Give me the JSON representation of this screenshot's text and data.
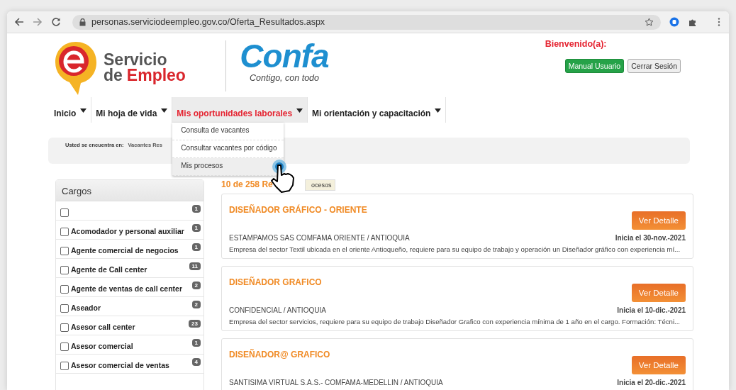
{
  "browser": {
    "url": "personas.serviciodeempleo.gov.co/Oferta_Resultados.aspx"
  },
  "header": {
    "logo_line1": "Servicio",
    "logo_line2_a": "de",
    "logo_line2_b": "Empleo",
    "partner_name": "Confa",
    "partner_tagline": "Contigo, con todo",
    "welcome": "Bienvenido(a):",
    "buttons": [
      {
        "label": "Manual Usuario",
        "kind": "primary"
      },
      {
        "label": "Cerrar Sesión",
        "kind": "secondary"
      }
    ]
  },
  "nav": [
    {
      "label": "Inicio",
      "selected": false
    },
    {
      "label": "Mi hoja de vida",
      "selected": false
    },
    {
      "label": "Mis oportunidades laborales",
      "selected": true,
      "menu": [
        {
          "label": "Consulta de vacantes",
          "highlighted": false
        },
        {
          "label": "Consultar vacantes por código",
          "highlighted": false
        },
        {
          "label": "Mis procesos",
          "highlighted": true
        }
      ]
    },
    {
      "label": "Mi orientación y capacitación",
      "selected": false
    }
  ],
  "breadcrumb": {
    "label": "Usted se encuentra en:",
    "current": "Vacantes Res"
  },
  "tooltip": "ocesos",
  "sidebar": {
    "title": "Cargos",
    "items": [
      {
        "checked": false,
        "count": "1"
      },
      {
        "label": "Acomodador y personal auxiliar",
        "checked": false,
        "count": "1"
      },
      {
        "label": "Agente comercial de negocios",
        "checked": false,
        "count": "1"
      },
      {
        "label": "Agente de Call center",
        "checked": false,
        "count": "11"
      },
      {
        "label": "Agente de ventas de call center",
        "checked": false,
        "count": "2"
      },
      {
        "label": "Aseador",
        "checked": false,
        "count": "2"
      },
      {
        "label": "Asesor call center",
        "checked": false,
        "count": "23"
      },
      {
        "label": "Asesor comercial",
        "checked": false,
        "count": "1"
      },
      {
        "label": "Asesor comercial de ventas",
        "checked": false,
        "count": "4"
      }
    ]
  },
  "results": {
    "count": "10 de 258 Re",
    "jobs": [
      {
        "title": "DISEÑADOR GRÁFICO - ORIENTE",
        "button": "Ver Detalle",
        "company": "ESTAMPAMOS SAS COMFAMA ORIENTE / ANTIOQUIA",
        "date": "Inicia el 30-nov.-2021",
        "description": "Empresa del sector Textil ubicada en el oriente Antioqueño, requiere para su equipo de trabajo y operación un Diseñador gráfico con experiencia mí..."
      },
      {
        "title": "DISEÑADOR GRAFICO",
        "button": "Ver Detalle",
        "company": "CONFIDENCIAL / ANTIOQUIA",
        "date": "Inicia el 10-dic.-2021",
        "description": "Empresa del sector servicios, requiere para su equipo de trabajo Diseñador Grafico con experiencia mínima de 1 año en el cargo. Formación: Técni..."
      },
      {
        "title": "DISEÑADOR@ GRAFICO",
        "button": "Ver Detalle",
        "company": "SANTISIMA VIRTUAL S.A.S.- COMFAMA-MEDELLIN / ANTIOQUIA",
        "date": "Inicia el 20-dic.-2021"
      }
    ]
  }
}
